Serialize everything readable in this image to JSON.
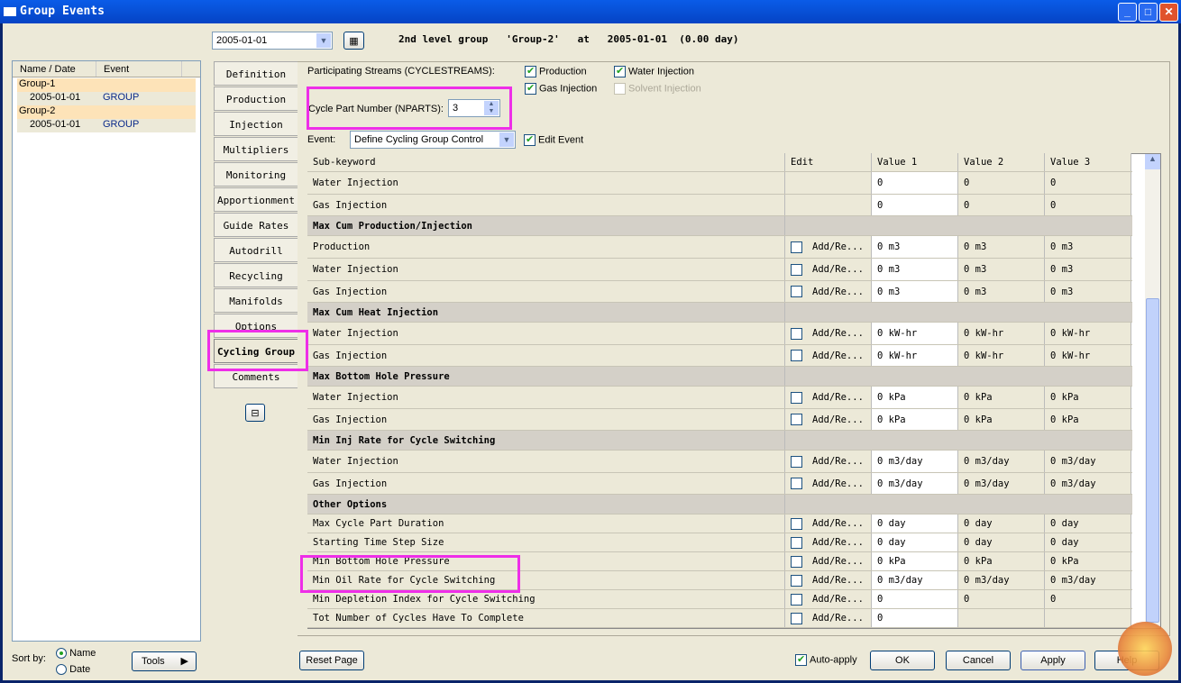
{
  "window": {
    "title": "Group Events",
    "minimize": "_",
    "maximize": "□",
    "close": "✕"
  },
  "top": {
    "date_value": "2005-01-01",
    "context": "2nd level group   'Group-2'   at   2005-01-01  (0.00 day)"
  },
  "tree": {
    "headers": [
      "Name / Date",
      "Event"
    ],
    "items": [
      {
        "name": "Group-1",
        "event": "",
        "group": true
      },
      {
        "name": "2005-01-01",
        "event": "GROUP",
        "group": false
      },
      {
        "name": "Group-2",
        "event": "",
        "group": true
      },
      {
        "name": "2005-01-01",
        "event": "GROUP",
        "group": false
      }
    ]
  },
  "sort": {
    "label": "Sort by:",
    "options": [
      "Name",
      "Date"
    ],
    "selected": "Name",
    "tools": "Tools"
  },
  "tabs": [
    "Definition",
    "Production",
    "Injection",
    "Multipliers",
    "Monitoring",
    "Apportionment",
    "Guide Rates",
    "Autodrill",
    "Recycling",
    "Manifolds",
    "Options",
    "Cycling Group",
    "Comments"
  ],
  "selected_tab": "Cycling Group",
  "form": {
    "streams_label": "Participating Streams (CYCLESTREAMS):",
    "streams": [
      {
        "label": "Production",
        "checked": true
      },
      {
        "label": "Water Injection",
        "checked": true
      },
      {
        "label": "Gas Injection",
        "checked": true
      },
      {
        "label": "Solvent Injection",
        "checked": false,
        "disabled": true
      }
    ],
    "nparts_label": "Cycle Part Number (NPARTS):",
    "nparts_value": "3",
    "event_label": "Event:",
    "event_value": "Define Cycling Group Control",
    "edit_event": "Edit Event"
  },
  "grid": {
    "headers": [
      "Sub-keyword",
      "Edit",
      "Value 1",
      "Value 2",
      "Value 3"
    ],
    "rows": [
      {
        "type": "data",
        "h": 25,
        "name": "Water Injection",
        "edit": false,
        "vals": [
          "0",
          "0",
          "0"
        ]
      },
      {
        "type": "data",
        "h": 24,
        "name": "Gas Injection",
        "edit": false,
        "vals": [
          "0",
          "0",
          "0"
        ]
      },
      {
        "type": "sec",
        "h": 22,
        "name": "Max Cum Production/Injection"
      },
      {
        "type": "data",
        "h": 25,
        "name": "Production",
        "edit": true,
        "vals": [
          "0 m3",
          "0 m3",
          "0 m3"
        ]
      },
      {
        "type": "data",
        "h": 25,
        "name": "Water Injection",
        "edit": true,
        "vals": [
          "0 m3",
          "0 m3",
          "0 m3"
        ]
      },
      {
        "type": "data",
        "h": 24,
        "name": "Gas Injection",
        "edit": true,
        "vals": [
          "0 m3",
          "0 m3",
          "0 m3"
        ]
      },
      {
        "type": "sec",
        "h": 22,
        "name": "Max Cum Heat Injection"
      },
      {
        "type": "data",
        "h": 25,
        "name": "Water Injection",
        "edit": true,
        "vals": [
          "0 kW-hr",
          "0 kW-hr",
          "0 kW-hr"
        ]
      },
      {
        "type": "data",
        "h": 24,
        "name": "Gas Injection",
        "edit": true,
        "vals": [
          "0 kW-hr",
          "0 kW-hr",
          "0 kW-hr"
        ]
      },
      {
        "type": "sec",
        "h": 22,
        "name": "Max Bottom Hole Pressure"
      },
      {
        "type": "data",
        "h": 25,
        "name": "Water Injection",
        "edit": true,
        "vals": [
          "0 kPa",
          "0 kPa",
          "0 kPa"
        ]
      },
      {
        "type": "data",
        "h": 24,
        "name": "Gas Injection",
        "edit": true,
        "vals": [
          "0 kPa",
          "0 kPa",
          "0 kPa"
        ]
      },
      {
        "type": "sec",
        "h": 22,
        "name": "Min Inj Rate for Cycle Switching"
      },
      {
        "type": "data",
        "h": 25,
        "name": "Water Injection",
        "edit": true,
        "vals": [
          "0 m3/day",
          "0 m3/day",
          "0 m3/day"
        ]
      },
      {
        "type": "data",
        "h": 24,
        "name": "Gas Injection",
        "edit": true,
        "vals": [
          "0 m3/day",
          "0 m3/day",
          "0 m3/day"
        ]
      },
      {
        "type": "sec",
        "h": 22,
        "name": "Other Options"
      },
      {
        "type": "data",
        "h": 21,
        "name": "Max Cycle Part Duration",
        "edit": true,
        "vals": [
          "0 day",
          "0 day",
          "0 day"
        ]
      },
      {
        "type": "data",
        "h": 21,
        "name": "Starting Time Step Size",
        "edit": true,
        "vals": [
          "0 day",
          "0 day",
          "0 day"
        ]
      },
      {
        "type": "data",
        "h": 21,
        "name": "Min Bottom Hole Pressure",
        "edit": true,
        "vals": [
          "0 kPa",
          "0 kPa",
          "0 kPa"
        ]
      },
      {
        "type": "data",
        "h": 21,
        "name": "Min Oil Rate for Cycle Switching",
        "edit": true,
        "vals": [
          "0 m3/day",
          "0 m3/day",
          "0 m3/day"
        ]
      },
      {
        "type": "data",
        "h": 21,
        "name": "Min Depletion Index for Cycle Switching",
        "edit": true,
        "vals": [
          "0",
          "0",
          "0"
        ]
      },
      {
        "type": "data",
        "h": 21,
        "name": "Tot Number of Cycles Have To Complete",
        "edit": true,
        "vals": [
          "0",
          "",
          ""
        ]
      }
    ],
    "edit_label": "Add/Re..."
  },
  "buttons": {
    "reset": "Reset Page",
    "auto_apply": "Auto-apply",
    "ok": "OK",
    "cancel": "Cancel",
    "apply": "Apply",
    "help": "Help"
  },
  "colors": {
    "highlight": "#ee2ee8",
    "title_bar": "#0a5ce8",
    "group_row": "#fde3b8"
  }
}
